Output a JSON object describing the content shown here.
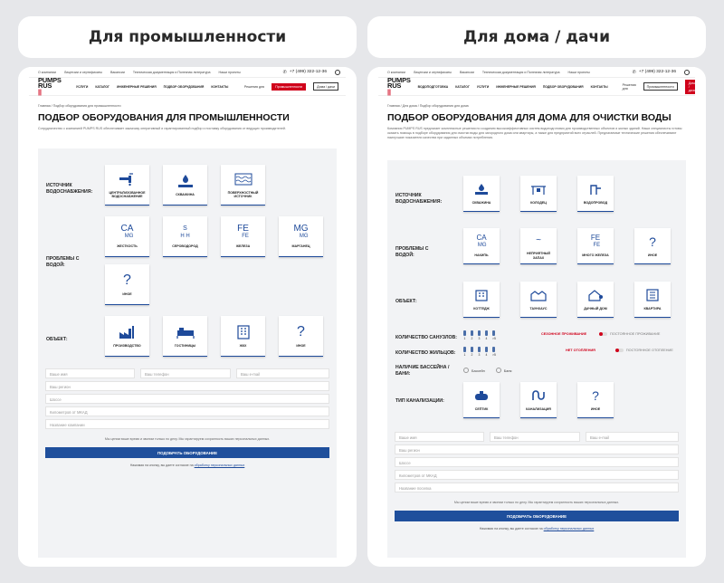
{
  "labels": {
    "left": "Для промышленности",
    "right": "Для дома / дачи"
  },
  "colors": {
    "brand_blue": "#1f4f9c",
    "brand_red": "#d0021b",
    "panel_bg": "#f2f3f5",
    "page_bg": "#e6e7ea"
  },
  "left": {
    "topbar": {
      "links": [
        "О компании",
        "Лицензии и сертификаты",
        "Вакансии",
        "Техническая документация и Полезная литература",
        "Наши проекты"
      ],
      "phone": "+7 (499) 322-12-36"
    },
    "logo": {
      "line1": "PUMPS",
      "line2": "RUS"
    },
    "nav": [
      "УСЛУГИ",
      "КАТАЛОГ",
      "ИНЖЕНЕРНЫЕ РЕШЕНИЯ",
      "ПОДБОР ОБОРУДОВАНИЯ",
      "КОНТАКТЫ"
    ],
    "switch_label": "Решения для",
    "switch_active": "Промышленности",
    "switch_other": "Дома / дачи",
    "breadcrumb": "Главная / Подбор оборудования для промышленности",
    "title": "ПОДБОР ОБОРУДОВАНИЯ ДЛЯ ПРОМЫШЛЕННОСТИ",
    "intro": "Сотрудничество с компанией PUMPS RUS обеспечивает заказчику оперативный и гарантированный подбор и поставку оборудования от ведущих производителей.",
    "rows": {
      "source": "ИСТОЧНИК ВОДОСНАБЖЕНИЯ:",
      "problems": "ПРОБЛЕМЫ С ВОДОЙ:",
      "object": "ОБЪЕКТ:"
    },
    "source_tiles": [
      "ЦЕНТРАЛИЗОВАННОЕ ВОДОСНАБЖЕНИЕ",
      "СКВАЖИНА",
      "ПОВЕРХНОСТНЫЙ ИСТОЧНИК"
    ],
    "problem_tiles": [
      {
        "label": "ЖЕСТКОСТЬ",
        "sym": "CA",
        "sub": "MG"
      },
      {
        "label": "СЕРОВОДОРОД",
        "sym": "S",
        "sub": "H H"
      },
      {
        "label": "ЖЕЛЕЗА",
        "sym": "FE",
        "sub": "FE"
      },
      {
        "label": "МАРГАНЕЦ",
        "sym": "MG",
        "sub": "MG"
      },
      {
        "label": "ИНОЕ",
        "sym": "?",
        "sub": ""
      }
    ],
    "object_tiles": [
      "ПРОИЗВОДСТВО",
      "ГОСТИНИЦЫ",
      "ЖКХ",
      "ИНОЕ"
    ],
    "form": {
      "name": "Ваше имя",
      "phone": "Ваш телефон",
      "email": "Ваш e-mail",
      "region": "Ваш регион",
      "road": "Шоссе",
      "km": "Километров от МКАД",
      "company": "Название компании"
    },
    "privacy": "Мы ценим ваше время и звоним только по делу. Мы гарантируем сохранность ваших персональных данных.",
    "submit": "ПОДОБРАТЬ ОБОРУДОВАНИЕ",
    "consent": "Нажимая на кнопку, вы даете согласие на",
    "consent_link": "обработку персональных данных"
  },
  "right": {
    "topbar": {
      "links": [
        "О компании",
        "Лицензии и сертификаты",
        "Вакансии",
        "Техническая документация и Полезная литература",
        "Наши проекты"
      ],
      "phone": "+7 (499) 322-12-36"
    },
    "logo": {
      "line1": "PUMPS",
      "line2": "RUS"
    },
    "nav": [
      "ВОДОПОДГОТОВКА",
      "КАТАЛОГ",
      "УСЛУГИ",
      "ИНЖЕНЕРНЫЕ РЕШЕНИЯ",
      "ПОДБОР ОБОРУДОВАНИЯ",
      "КОНТАКТЫ"
    ],
    "switch_label": "Решения для",
    "switch_active": "Дома / дачи",
    "switch_other": "Промышленности",
    "breadcrumb": "Главная / Для дома / Подбор оборудования для дома",
    "title": "ПОДБОР ОБОРУДОВАНИЯ ДЛЯ ДОМА ДЛЯ ОЧИСТКИ ВОДЫ",
    "intro": "Компания PUMPS RUS предлагает комплексные решения по созданию высокоэффективных систем водоподготовки для производственных объектов и жилых зданий. Наши специалисты готовы оказать помощь в подборе оборудования для очистки воды для загородного дома или квартиры, а также для предприятий всех отраслей. Предлагаемые технические решения обеспечивают наилучшие показатели качества при заданных объемах потребления.",
    "rows": {
      "source": "ИСТОЧНИК ВОДОСНАБЖЕНИЯ:",
      "problems": "ПРОБЛЕМЫ С ВОДОЙ:",
      "object": "ОБЪЕКТ:",
      "baths": "КОЛИЧЕСТВО САНУЗЛОВ:",
      "residents": "КОЛИЧЕСТВО ЖИЛЬЦОВ:",
      "pool": "НАЛИЧИЕ БАССЕЙНА / БАНИ:",
      "sewer": "ТИП КАНАЛИЗАЦИИ:"
    },
    "source_tiles": [
      "СКВАЖИНА",
      "КОЛОДЕЦ",
      "ВОДОПРОВОД"
    ],
    "problem_tiles": [
      {
        "label": "НАКИПЬ",
        "sym": "CA",
        "sub": "MG"
      },
      {
        "label": "НЕПРИЯТНЫЙ ЗАПАХ",
        "sym": "~",
        "sub": ""
      },
      {
        "label": "МНОГО ЖЕЛЕЗА",
        "sym": "FE",
        "sub": "FE"
      },
      {
        "label": "ИНОЕ",
        "sym": "?",
        "sub": ""
      }
    ],
    "object_tiles": [
      "КОТТЕДЖ",
      "ТАУНХАУС",
      "ДАЧНЫЙ ДОМ",
      "КВАРТИРА"
    ],
    "counts": [
      "1",
      "2",
      "3",
      "4",
      ">5"
    ],
    "toggle1": {
      "active": "СЕЗОННОЕ ПРОЖИВАНИЕ",
      "other": "ПОСТОЯННОЕ ПРОЖИВАНИЕ"
    },
    "toggle2": {
      "active": "НЕТ ОТОПЛЕНИЯ",
      "other": "ПОСТОЯННОЕ ОТОПЛЕНИЕ"
    },
    "pool_options": [
      "Бассейн",
      "Баня"
    ],
    "sewer_tiles": [
      "СЕПТИК",
      "КАНАЛИЗАЦИЯ",
      "ИНОЕ"
    ],
    "form": {
      "name": "Ваше имя",
      "phone": "Ваш телефон",
      "email": "Ваш e-mail",
      "region": "Ваш регион",
      "road": "Шоссе",
      "km": "Километров от МКАД",
      "company": "Название поселка"
    },
    "privacy": "Мы ценим ваше время и звоним только по делу. Мы гарантируем сохранность ваших персональных данных.",
    "submit": "ПОДОБРАТЬ ОБОРУДОВАНИЕ",
    "consent": "Нажимая на кнопку, вы даете согласие на",
    "consent_link": "обработку персональных данных"
  }
}
